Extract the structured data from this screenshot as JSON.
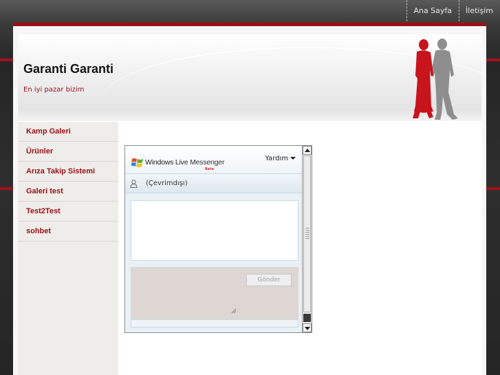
{
  "nav": {
    "items": [
      {
        "label": "Ana Sayfa"
      },
      {
        "label": "İletişim"
      }
    ]
  },
  "site": {
    "title": "Garanti Garanti",
    "slogan": "En iyi pazar bizim"
  },
  "sidebar": {
    "items": [
      {
        "label": "Kamp Galeri"
      },
      {
        "label": "Ürünler"
      },
      {
        "label": "Arıza Takip Sistemi"
      },
      {
        "label": "Galeri test"
      },
      {
        "label": "Test2Test"
      },
      {
        "label": "sohbet"
      }
    ]
  },
  "messenger": {
    "brand": "Windows Live",
    "brand_product": "Messenger",
    "beta": "Beta",
    "help_label": "Yardım",
    "status": "(Çevrimdışı)",
    "send_label": "Gönder"
  },
  "colors": {
    "accent_red": "#9e0d14",
    "link_red": "#9a0f16",
    "background_dark": "#2b2b2b"
  }
}
